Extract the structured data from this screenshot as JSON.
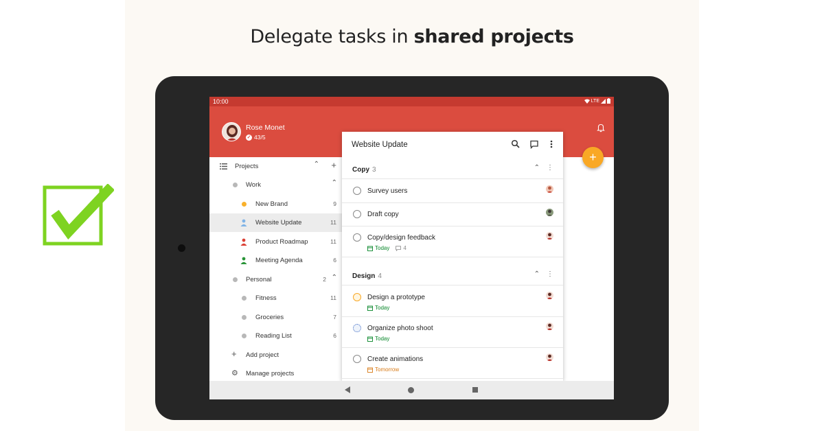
{
  "headline": {
    "normal": "Delegate tasks in ",
    "bold": "shared projects"
  },
  "status_bar": {
    "time": "10:00",
    "network": "LTE"
  },
  "user": {
    "name": "Rose Monet",
    "karma": "43/5"
  },
  "sidebar": {
    "projects_label": "Projects",
    "items": [
      {
        "label": "Work",
        "count": ""
      },
      {
        "label": "New Brand",
        "count": "9"
      },
      {
        "label": "Website Update",
        "count": "11"
      },
      {
        "label": "Product Roadmap",
        "count": "11"
      },
      {
        "label": "Meeting Agenda",
        "count": "6"
      },
      {
        "label": "Personal",
        "count": "2"
      },
      {
        "label": "Fitness",
        "count": "11"
      },
      {
        "label": "Groceries",
        "count": "7"
      },
      {
        "label": "Reading List",
        "count": "6"
      }
    ],
    "add_project": "Add project",
    "manage_projects": "Manage projects"
  },
  "main": {
    "title": "Website Update",
    "sections": [
      {
        "name": "Copy",
        "count": "3",
        "tasks": [
          {
            "name": "Survey users",
            "due": "",
            "comments": ""
          },
          {
            "name": "Draft copy",
            "due": "",
            "comments": ""
          },
          {
            "name": "Copy/design feedback",
            "due": "Today",
            "comments": "4"
          }
        ]
      },
      {
        "name": "Design",
        "count": "4",
        "tasks": [
          {
            "name": "Design a prototype",
            "due": "Today",
            "comments": ""
          },
          {
            "name": "Organize photo shoot",
            "due": "Today",
            "comments": ""
          },
          {
            "name": "Create animations",
            "due": "Tomorrow",
            "comments": ""
          }
        ]
      }
    ]
  },
  "colors": {
    "brand_red": "#db4c3f",
    "status_red": "#c53a30",
    "fab": "#f9a825",
    "today_green": "#058527",
    "tomorrow_orange": "#d87a16",
    "check_green": "#7ed321"
  }
}
